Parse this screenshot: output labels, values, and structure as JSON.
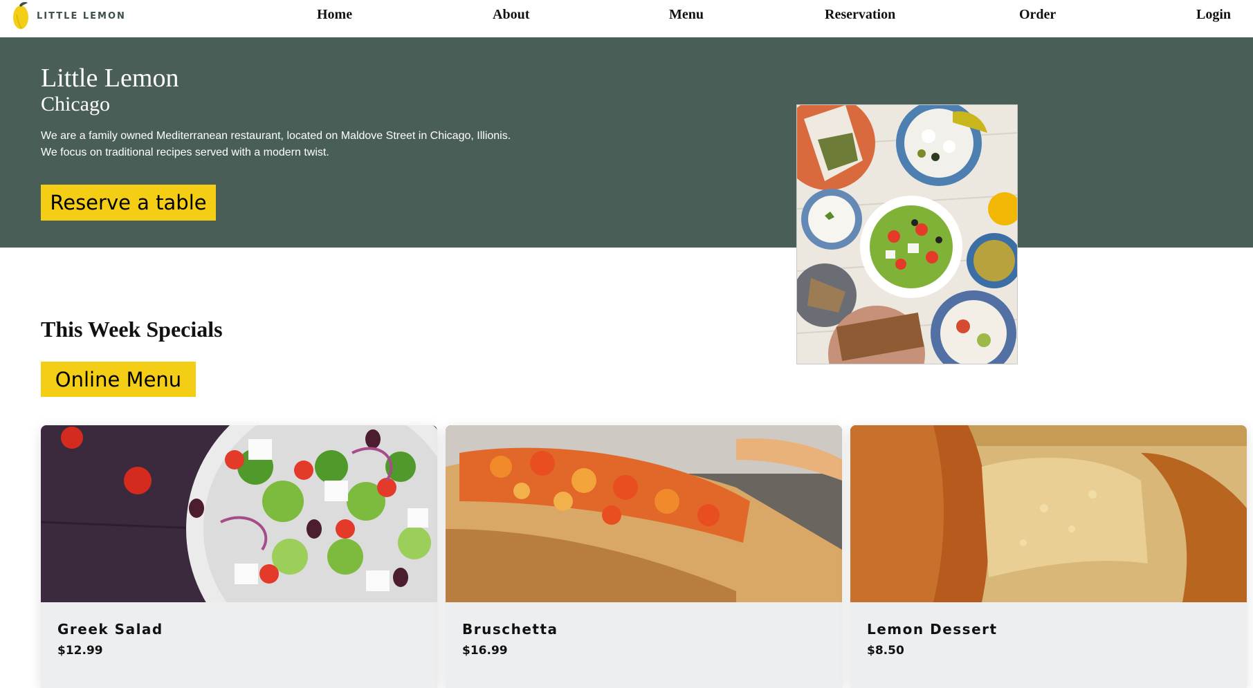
{
  "brand": {
    "name": "LITTLE LEMON",
    "colors": {
      "green": "#495e57",
      "yellow": "#f4ce14"
    }
  },
  "nav": {
    "items": [
      {
        "label": "Home"
      },
      {
        "label": "About"
      },
      {
        "label": "Menu"
      },
      {
        "label": "Reservation"
      },
      {
        "label": "Order"
      },
      {
        "label": "Login"
      }
    ]
  },
  "hero": {
    "title": "Little Lemon",
    "subtitle": "Chicago",
    "description_line1": "We are a family owned Mediterranean restaurant, located on Maldove Street in Chicago, Illionis.",
    "description_line2": "We focus on traditional recipes served with a modern twist.",
    "cta_label": "Reserve a table",
    "image_icon": "mediterranean-food-platter-image"
  },
  "specials": {
    "title": "This Week Specials",
    "menu_button_label": "Online Menu",
    "cards": [
      {
        "name": "Greek Salad",
        "price": "$12.99",
        "image_icon": "greek-salad-image"
      },
      {
        "name": "Bruschetta",
        "price": "$16.99",
        "image_icon": "bruschetta-image"
      },
      {
        "name": "Lemon Dessert",
        "price": "$8.50",
        "image_icon": "lemon-dessert-image"
      }
    ]
  }
}
